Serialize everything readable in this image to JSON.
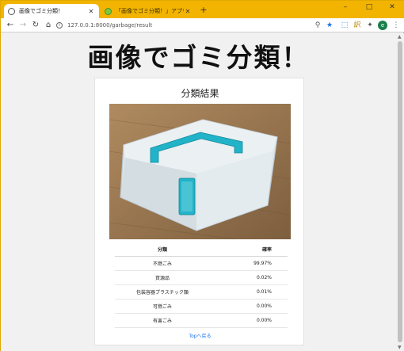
{
  "browser": {
    "tabs": [
      {
        "title": "画像でゴミ分類！",
        "active": true
      },
      {
        "title": "「画像でゴミ分類！」アプリ作成日誌",
        "active": false
      }
    ],
    "url": "127.0.0.1:8000/garbage/result",
    "profile_initial": "e",
    "window_controls": [
      "–",
      "□",
      "✕"
    ]
  },
  "page": {
    "title": "画像でゴミ分類！",
    "card_title": "分類結果",
    "table": {
      "headers": [
        "分類",
        "確率"
      ],
      "rows": [
        {
          "label": "不燃ごみ",
          "value": "99.97%"
        },
        {
          "label": "資源品",
          "value": "0.02%"
        },
        {
          "label": "包装容器プラスチック類",
          "value": "0.01%"
        },
        {
          "label": "可燃ごみ",
          "value": "0.00%"
        },
        {
          "label": "有害ごみ",
          "value": "0.00%"
        }
      ]
    },
    "back_link": "Topへ戻る"
  },
  "colors": {
    "tab_strip": "#f2b400",
    "photo_floor": "#9a7a54",
    "case_handle": "#21b3c8",
    "link": "#1a73e8"
  }
}
